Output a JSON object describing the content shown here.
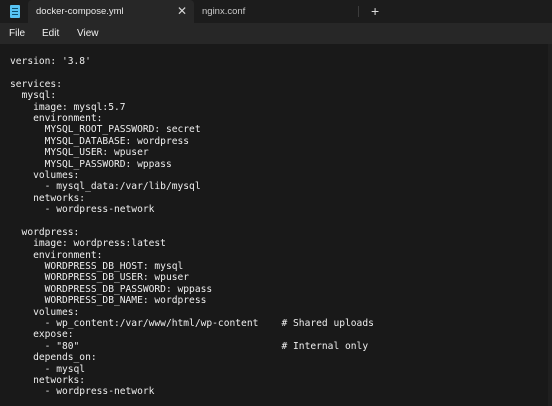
{
  "tabs": [
    {
      "label": "docker-compose.yml",
      "active": true
    },
    {
      "label": "nginx.conf",
      "active": false
    }
  ],
  "tab_close_glyph": "✕",
  "new_tab_glyph": "+",
  "menu": [
    "File",
    "Edit",
    "View"
  ],
  "code_lines": [
    "version: '3.8'",
    "",
    "services:",
    "  mysql:",
    "    image: mysql:5.7",
    "    environment:",
    "      MYSQL_ROOT_PASSWORD: secret",
    "      MYSQL_DATABASE: wordpress",
    "      MYSQL_USER: wpuser",
    "      MYSQL_PASSWORD: wppass",
    "    volumes:",
    "      - mysql_data:/var/lib/mysql",
    "    networks:",
    "      - wordpress-network",
    "",
    "  wordpress:",
    "    image: wordpress:latest",
    "    environment:",
    "      WORDPRESS_DB_HOST: mysql",
    "      WORDPRESS_DB_USER: wpuser",
    "      WORDPRESS_DB_PASSWORD: wppass",
    "      WORDPRESS_DB_NAME: wordpress",
    "    volumes:",
    "      - wp_content:/var/www/html/wp-content    # Shared uploads",
    "    expose:",
    "      - \"80\"                                   # Internal only",
    "    depends_on:",
    "      - mysql",
    "    networks:",
    "      - wordpress-network"
  ],
  "colors": {
    "titlebar": "#1c1c1c",
    "active_tab": "#272727",
    "editor_bg": "#191919",
    "app_icon": "#58c4f4"
  }
}
